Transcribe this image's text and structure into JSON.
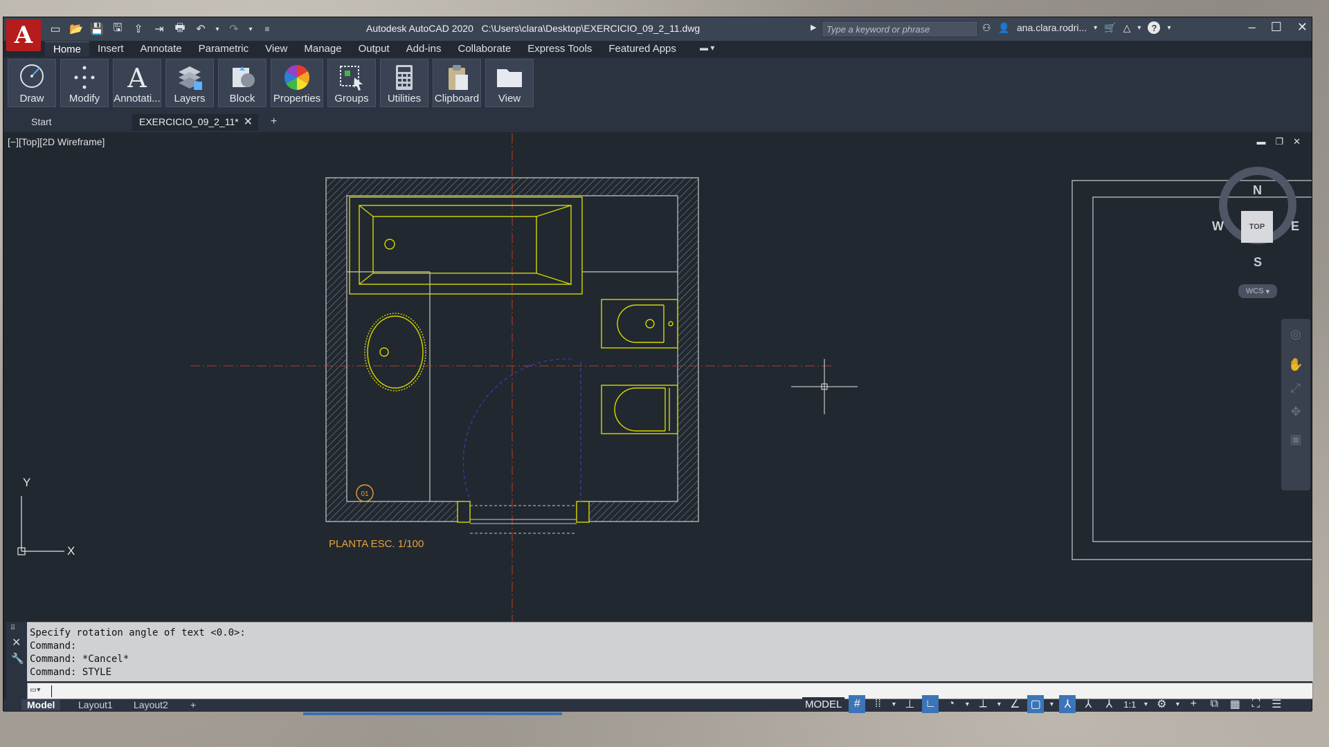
{
  "app": {
    "logo_letter": "A",
    "title": "Autodesk AutoCAD 2020",
    "file_path": "C:\\Users\\clara\\Desktop\\EXERCICIO_09_2_11.dwg",
    "search_placeholder": "Type a keyword or phrase",
    "user": "ana.clara.rodri...",
    "help": "?"
  },
  "ribbon_tabs": [
    "Home",
    "Insert",
    "Annotate",
    "Parametric",
    "View",
    "Manage",
    "Output",
    "Add-ins",
    "Collaborate",
    "Express Tools",
    "Featured Apps"
  ],
  "ribbon_panels": [
    "Draw",
    "Modify",
    "Annotati...",
    "Layers",
    "Block",
    "Properties",
    "Groups",
    "Utilities",
    "Clipboard",
    "View"
  ],
  "file_tabs": {
    "start": "Start",
    "document": "EXERCICIO_09_2_11*",
    "close": "✕",
    "new": "+"
  },
  "viewport": {
    "label": "[−][Top][2D Wireframe]"
  },
  "viewcube": {
    "north": "N",
    "south": "S",
    "east": "E",
    "west": "W",
    "top": "TOP",
    "wcs": "WCS"
  },
  "drawing": {
    "title": "PLANTA ESC. 1/100",
    "tag": "01",
    "axis_y": "Y",
    "axis_x": "X"
  },
  "colors": {
    "wall": "#c8c8c8",
    "fixture": "#d8d800",
    "axis": "#b2401f",
    "annotation": "#e8a23a",
    "door_swing": "#3a3aa0"
  },
  "command": {
    "history": [
      "Specify rotation angle of text <0.0>:",
      "Command:",
      "Command: *Cancel*",
      "Command: STYLE"
    ],
    "input": ""
  },
  "status": {
    "layout_tabs": [
      "Model",
      "Layout1",
      "Layout2"
    ],
    "add": "+",
    "model": "MODEL",
    "scale": "1:1"
  }
}
